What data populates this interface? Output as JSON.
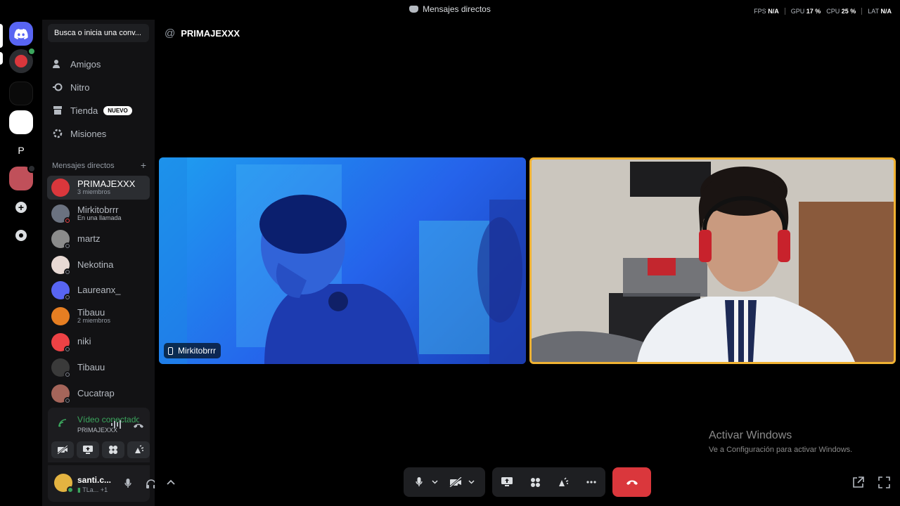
{
  "window": {
    "title": "Mensajes directos",
    "stats": [
      {
        "label": "FPS",
        "value": "N/A"
      },
      {
        "label": "GPU",
        "value": "17 %"
      },
      {
        "label": "CPU",
        "value": "25 %"
      },
      {
        "label": "LAT",
        "value": "N/A"
      }
    ]
  },
  "rail": {
    "servers": [
      {
        "name": "discord-home-icon"
      },
      {
        "name": "group-dm-icon"
      },
      {
        "name": "server-black"
      },
      {
        "name": "server-white"
      },
      {
        "name": "server-p",
        "letter": "P"
      },
      {
        "name": "server-avatar"
      },
      {
        "name": "add-server-icon",
        "glyph": "+"
      },
      {
        "name": "discover-icon"
      }
    ]
  },
  "sidebar": {
    "search_placeholder": "Busca o inicia una conv...",
    "nav": [
      {
        "label": "Amigos"
      },
      {
        "label": "Nitro"
      },
      {
        "label": "Tienda",
        "badge": "NUEVO"
      },
      {
        "label": "Misiones"
      }
    ],
    "dm_header": "Mensajes directos",
    "dm_add": "+",
    "dms": [
      {
        "name": "PRIMAJEXXX",
        "sub": "3 miembros",
        "active": true,
        "color": "#da373c"
      },
      {
        "name": "Mirkitobrrr",
        "sub": "En una llamada",
        "active": false,
        "color": "#6b7280"
      },
      {
        "name": "martz",
        "sub": "",
        "active": false,
        "color": "#8b8b8b"
      },
      {
        "name": "Nekotina",
        "sub": "",
        "active": false,
        "color": "#e8d9d4"
      },
      {
        "name": "Laureanx_",
        "sub": "",
        "active": false,
        "color": "#5865f2"
      },
      {
        "name": "Tibauu",
        "sub": "2 miembros",
        "active": false,
        "color": "#e67e22"
      },
      {
        "name": "niki",
        "sub": "",
        "active": false,
        "color": "#ed4245"
      },
      {
        "name": "Tibauu",
        "sub": "",
        "active": false,
        "color": "#3a3a3a"
      },
      {
        "name": "Cucatrap",
        "sub": "",
        "active": false,
        "color": "#a5655a"
      }
    ]
  },
  "voice": {
    "status": "Vídeo conectado",
    "channel": "PRIMAJEXXX"
  },
  "user": {
    "name": "santi.c...",
    "activity": "TLa...",
    "extra": "+1"
  },
  "main": {
    "channel_name": "PRIMAJEXXX",
    "tiles": [
      {
        "label": "Mirkitobrrr"
      }
    ],
    "watermark_title": "Activar Windows",
    "watermark_sub": "Ve a Configuración para activar Windows."
  },
  "colors": {
    "accent": "#5865f2",
    "speaking": "#f0b232",
    "hangup": "#da373c",
    "connected": "#3ba55d"
  }
}
